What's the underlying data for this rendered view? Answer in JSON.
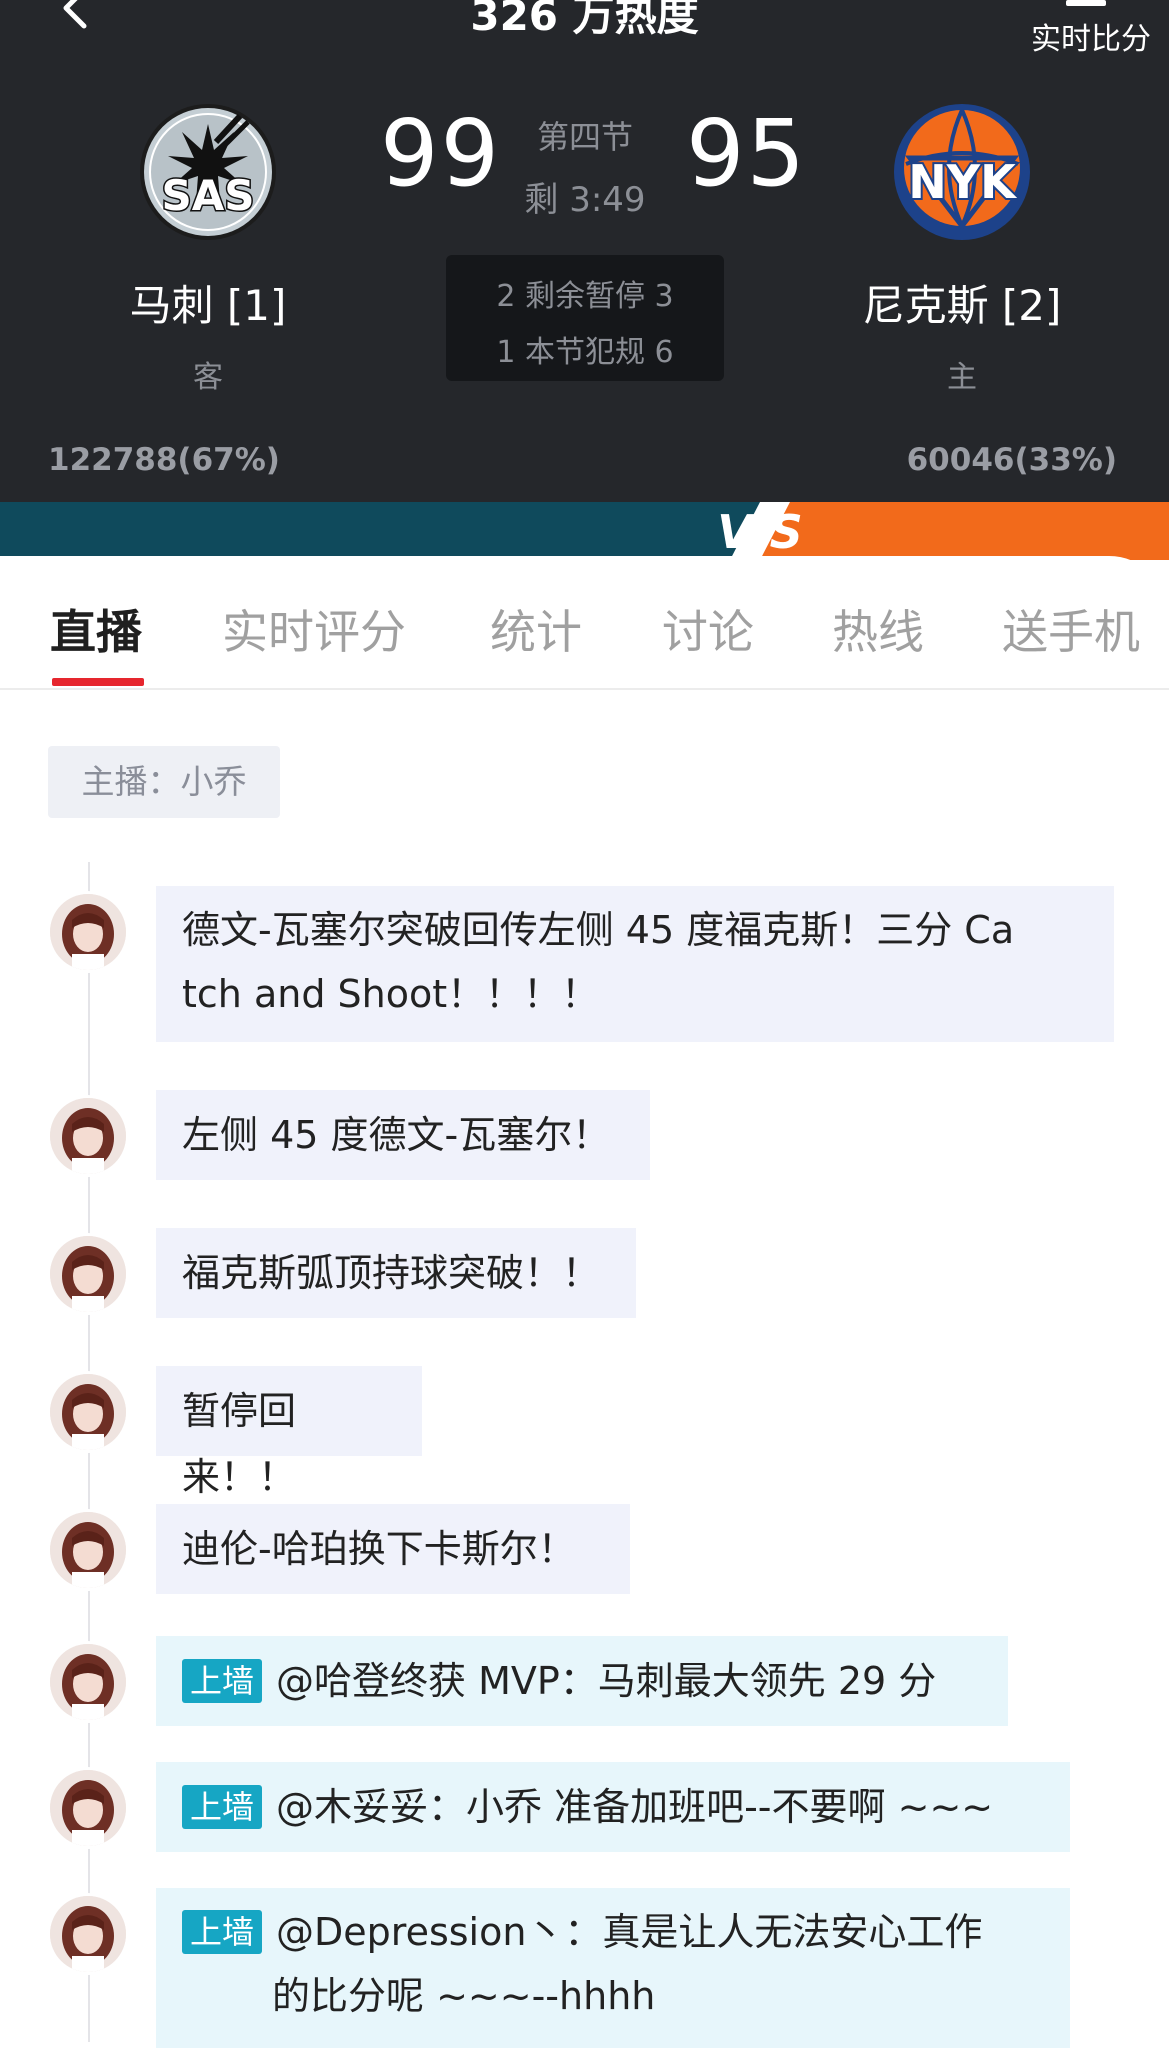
{
  "header": {
    "heat_title": "326 万热度",
    "realtime_score_label": "实时比分"
  },
  "away_team": {
    "name": "马刺 [1]",
    "side_label": "客",
    "score": "99",
    "support": "122788(67%)",
    "logo_text": "SAS",
    "color": "#c4ced4"
  },
  "home_team": {
    "name": "尼克斯 [2]",
    "side_label": "主",
    "score": "95",
    "support": "60046(33%)",
    "logo_text": "NYK",
    "color": "#f26a1b"
  },
  "game": {
    "period": "第四节",
    "time_left": "剩 3:49",
    "timeouts_row": "2 剩余暂停 3",
    "fouls_row": "1 本节犯规 6"
  },
  "tabs": [
    {
      "label": "直播",
      "active": true
    },
    {
      "label": "实时评分",
      "active": false
    },
    {
      "label": "统计",
      "active": false
    },
    {
      "label": "讨论",
      "active": false
    },
    {
      "label": "热线",
      "active": false
    },
    {
      "label": "送手机",
      "active": false
    }
  ],
  "host_label": "主播：小乔",
  "wall_tag": "上墙",
  "feed": [
    {
      "text": "德文-瓦塞尔突破回传左侧 45 度福克斯！三分 Ca",
      "text2": "tch and Shoot！！！！"
    },
    {
      "text": "左侧 45 度德文-瓦塞尔！"
    },
    {
      "text": "福克斯弧顶持球突破！！"
    },
    {
      "text": "暂停回来！！"
    },
    {
      "text": "迪伦-哈珀换下卡斯尔！"
    },
    {
      "text": "@哈登终获 MVP：马刺最大领先 29 分"
    },
    {
      "text": "@木妥妥：小乔 准备加班吧--不要啊 ~~~"
    },
    {
      "text": "@Depression丶：真是让人无法安心工作",
      "text2": "的比分呢 ~~~--hhhh"
    }
  ],
  "colors": {
    "header_bg": "#25272b",
    "active_tab_underline": "#e6262e",
    "wall_tag": "#16a6c4",
    "vs_left": "#0f4a5c",
    "vs_right": "#f26a1b"
  }
}
